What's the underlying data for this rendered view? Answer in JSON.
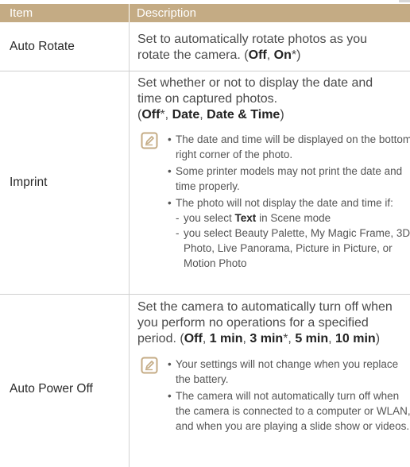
{
  "header": {
    "col1": "Item",
    "col2": "Description"
  },
  "rows": [
    {
      "item": "Auto Rotate",
      "desc_line1": "Set to automatically rotate photos as you",
      "desc_line2_pre": "rotate the camera. (",
      "opt1": "Off",
      "sep1": ", ",
      "opt2": "On",
      "tail": "*)"
    },
    {
      "item": "Imprint",
      "desc_line1": "Set whether or not to display the date and",
      "desc_line2": "time on captured photos.",
      "opt_open": "(",
      "opt1": "Off",
      "opt1_mark": "*, ",
      "opt2": "Date",
      "sep2": ", ",
      "opt3": "Date & Time",
      "opt_close": ")",
      "notes": [
        "The date and time will be displayed on the bottom right corner of the photo.",
        "Some printer models may not print the date and time properly.",
        "The photo will not display the date and time if:"
      ],
      "subs": {
        "s1_pre": "you select ",
        "s1_bold": "Text",
        "s1_post": " in Scene mode",
        "s2": "you select Beauty Palette, My Magic Frame, 3D Photo, Live Panorama, Picture in Picture, or Motion Photo"
      }
    },
    {
      "item": "Auto Power Off",
      "desc_line1": "Set the camera to automatically turn off when",
      "desc_line2": "you perform no operations for a specified",
      "desc_line3_pre": "period. (",
      "o1": "Off",
      "s1": ", ",
      "o2": "1 min",
      "s2": ", ",
      "o3": "3 min",
      "s3": "*, ",
      "o4": "5 min",
      "s4": ", ",
      "o5": "10 min",
      "close": ")",
      "notes": [
        "Your settings will not change when you replace the battery.",
        "The camera will not automatically turn off when the camera is connected to a computer or WLAN, and when you are playing a slide show or videos."
      ]
    }
  ],
  "colors": {
    "header_bg": "#c4ab84",
    "note_icon": "#c4ab84",
    "rule": "#cfcfcf"
  },
  "icons": {
    "note": "note-pencil-icon"
  }
}
